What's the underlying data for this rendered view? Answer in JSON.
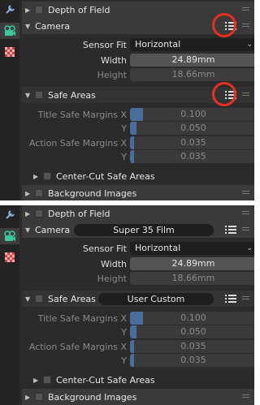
{
  "colors": {
    "highlight": "#e53020",
    "slider_fill": "#4a6e9c",
    "camera_tab": "#3cc8a0",
    "texture_tab": "#d04040"
  },
  "icons": [
    "wrench-icon",
    "camera-data-icon",
    "texture-checker-icon",
    "preset-list-icon",
    "panel-grip-icon"
  ],
  "top_panel": {
    "depth_of_field": "Depth of Field",
    "camera": {
      "label": "Camera",
      "preset": ""
    },
    "sensor_fit": {
      "label": "Sensor Fit",
      "value": "Horizontal"
    },
    "width": {
      "label": "Width",
      "value": "24.89mm"
    },
    "height": {
      "label": "Height",
      "value": "18.66mm"
    },
    "safe_areas": {
      "label": "Safe Areas",
      "preset": ""
    },
    "title_x": {
      "label": "Title Safe Margins X",
      "value": "0.100",
      "level": 0.1
    },
    "title_y": {
      "label": "Y",
      "value": "0.050",
      "level": 0.05
    },
    "action_x": {
      "label": "Action Safe Margins X",
      "value": "0.035",
      "level": 0.035
    },
    "action_y": {
      "label": "Y",
      "value": "0.035",
      "level": 0.035
    },
    "center_cut": "Center-Cut Safe Areas",
    "background_images": "Background Images"
  },
  "bottom_panel": {
    "depth_of_field": "Depth of Field",
    "camera": {
      "label": "Camera",
      "preset": "Super 35 Film"
    },
    "sensor_fit": {
      "label": "Sensor Fit",
      "value": "Horizontal"
    },
    "width": {
      "label": "Width",
      "value": "24.89mm"
    },
    "height": {
      "label": "Height",
      "value": "18.66mm"
    },
    "safe_areas": {
      "label": "Safe Areas",
      "preset": "User Custom"
    },
    "title_x": {
      "label": "Title Safe Margins X",
      "value": "0.100",
      "level": 0.1
    },
    "title_y": {
      "label": "Y",
      "value": "0.050",
      "level": 0.05
    },
    "action_x": {
      "label": "Action Safe Margins X",
      "value": "0.035",
      "level": 0.035
    },
    "action_y": {
      "label": "Y",
      "value": "0.035",
      "level": 0.035
    },
    "center_cut": "Center-Cut Safe Areas",
    "background_images": "Background Images"
  }
}
